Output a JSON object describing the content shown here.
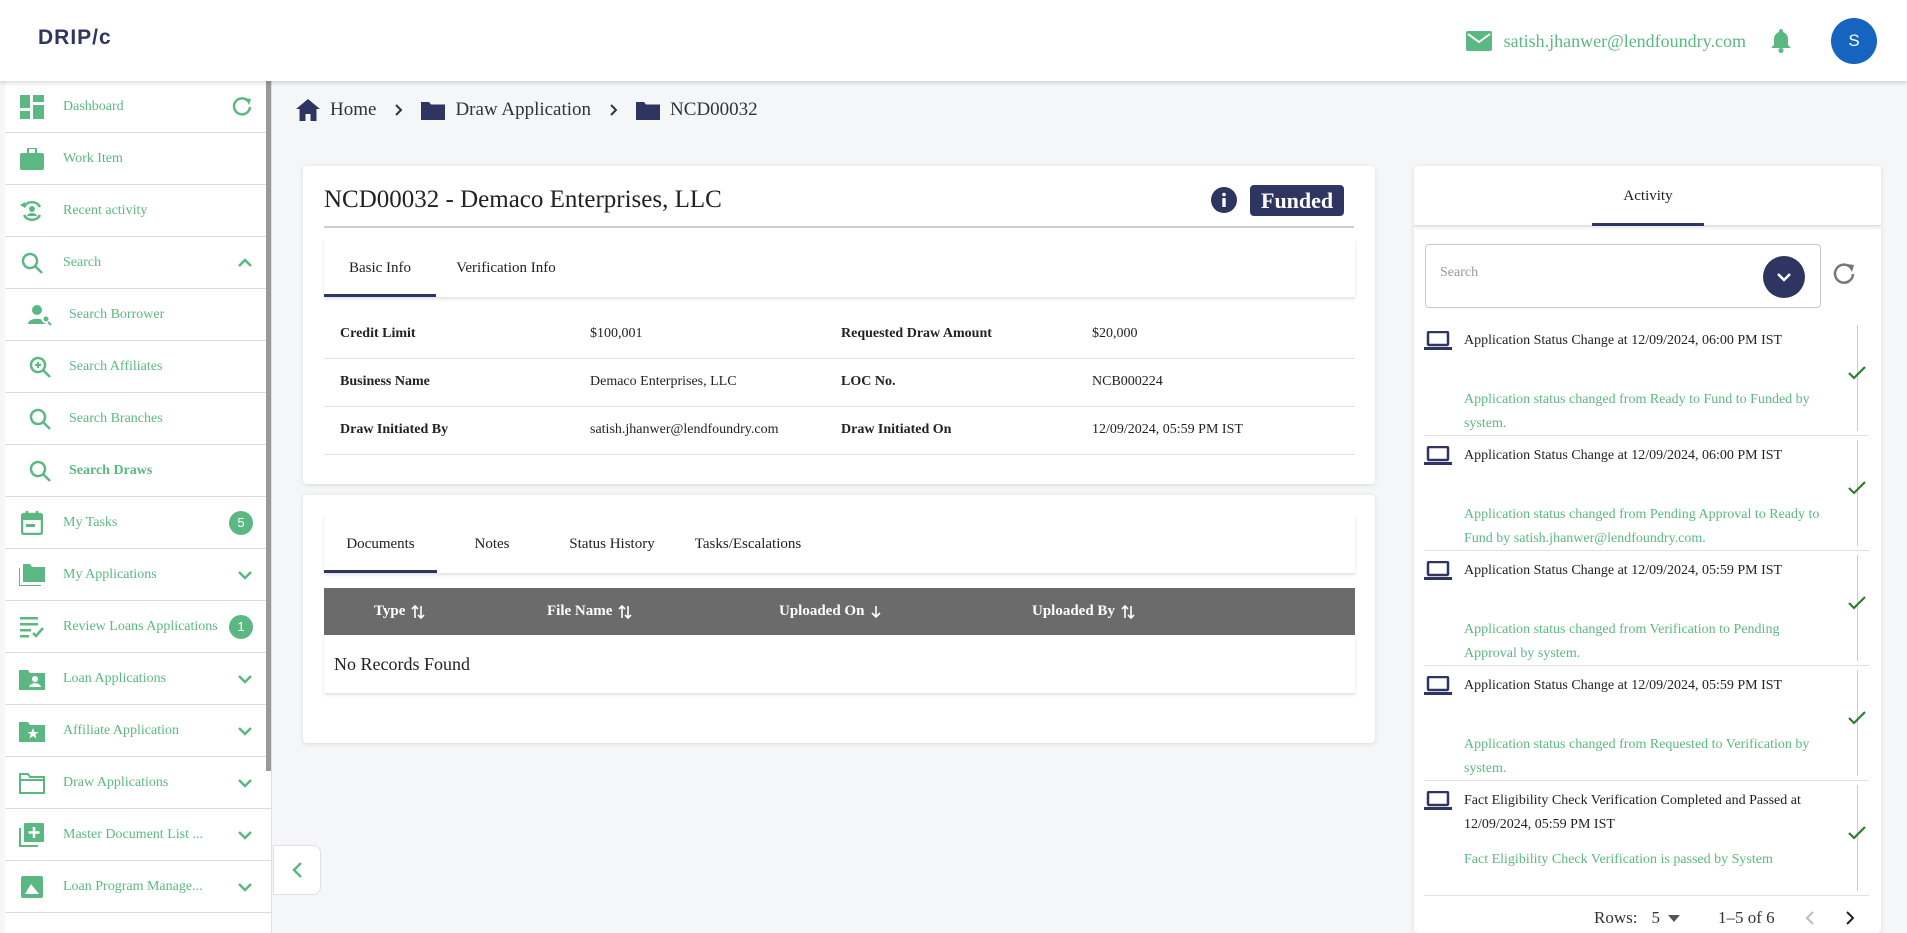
{
  "app": {
    "logo": "DRIP/c",
    "user_email": "satish.jhanwer@lendfoundry.com",
    "avatar_initial": "S"
  },
  "sidebar": {
    "items": [
      {
        "label": "Dashboard",
        "icon": "dashboard-icon"
      },
      {
        "label": "Work Item",
        "icon": "briefcase-icon"
      },
      {
        "label": "Recent activity",
        "icon": "recent-activity-icon"
      },
      {
        "label": "Search",
        "icon": "search-icon"
      },
      {
        "label": "Search Borrower",
        "icon": "person-search-icon"
      },
      {
        "label": "Search Affiliates",
        "icon": "zoom-in-icon"
      },
      {
        "label": "Search Branches",
        "icon": "search-icon"
      },
      {
        "label": "Search Draws",
        "icon": "search-icon"
      },
      {
        "label": "My Tasks",
        "icon": "calendar-icon",
        "badge": "5"
      },
      {
        "label": "My Applications",
        "icon": "folders-icon"
      },
      {
        "label": "Review Loans Applications",
        "icon": "checklist-icon",
        "badge": "1"
      },
      {
        "label": "Loan Applications",
        "icon": "folder-person-icon"
      },
      {
        "label": "Affiliate Application",
        "icon": "folder-star-icon"
      },
      {
        "label": "Draw Applications",
        "icon": "folder-outline-icon"
      },
      {
        "label": "Master Document List ...",
        "icon": "library-add-icon"
      },
      {
        "label": "Loan Program Manage...",
        "icon": "photo-frame-icon"
      }
    ]
  },
  "breadcrumb": {
    "home": "Home",
    "section": "Draw Application",
    "current": "NCD00032"
  },
  "application": {
    "title": "NCD00032 - Demaco Enterprises, LLC",
    "status": "Funded",
    "tabs": [
      "Basic Info",
      "Verification Info"
    ],
    "fields": {
      "credit_limit_label": "Credit Limit",
      "credit_limit": "$100,001",
      "requested_label": "Requested Draw Amount",
      "requested": "$20,000",
      "business_label": "Business Name",
      "business": "Demaco Enterprises, LLC",
      "loc_label": "LOC No.",
      "loc": "NCB000224",
      "initiated_by_label": "Draw Initiated By",
      "initiated_by": "satish.jhanwer@lendfoundry.com",
      "initiated_on_label": "Draw Initiated On",
      "initiated_on": "12/09/2024, 05:59 PM IST"
    }
  },
  "documents": {
    "tabs": [
      "Documents",
      "Notes",
      "Status History",
      "Tasks/Escalations"
    ],
    "columns": [
      "Type",
      "File Name",
      "Uploaded On",
      "Uploaded By"
    ],
    "empty_text": "No Records Found"
  },
  "activity": {
    "tab": "Activity",
    "search_placeholder": "Search",
    "items": [
      {
        "title": "Application Status Change at 12/09/2024, 06:00 PM IST",
        "desc": "Application status changed from Ready to Fund to Funded by system."
      },
      {
        "title": "Application Status Change at 12/09/2024, 06:00 PM IST",
        "desc": "Application status changed from Pending Approval to Ready to Fund by satish.jhanwer@lendfoundry.com."
      },
      {
        "title": "Application Status Change at 12/09/2024, 05:59 PM IST",
        "desc": "Application status changed from Verification to Pending Approval by system."
      },
      {
        "title": "Application Status Change at 12/09/2024, 05:59 PM IST",
        "desc": "Application status changed from Requested to Verification by system."
      },
      {
        "title": "Fact Eligibility Check Verification Completed and Passed at 12/09/2024, 05:59 PM IST",
        "desc": "Fact Eligibility Check Verification is passed by System"
      }
    ],
    "pagination": {
      "rows_label": "Rows:",
      "rows_value": "5",
      "range": "1–5 of 6"
    }
  },
  "colors": {
    "accent_green": "#5cb882",
    "navy": "#2f3561",
    "table_header": "#6b6b6b",
    "avatar_blue": "#1565c0"
  }
}
